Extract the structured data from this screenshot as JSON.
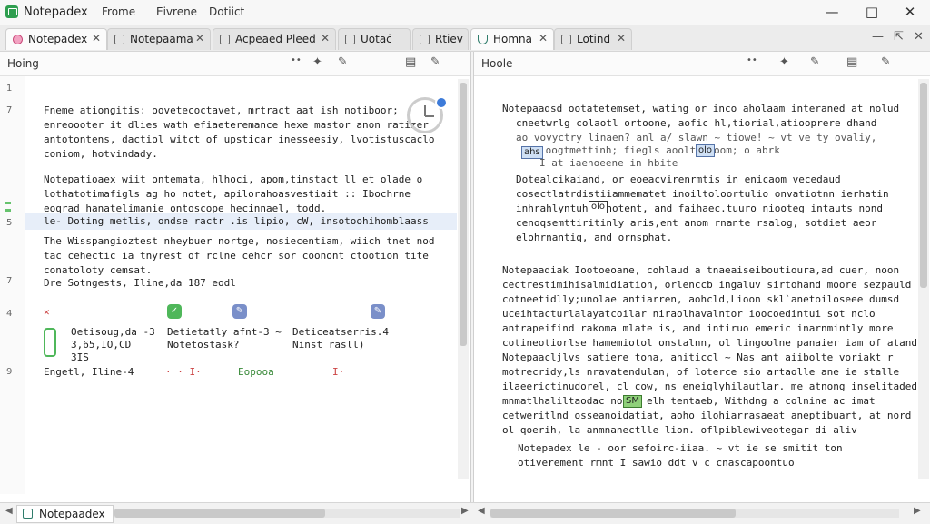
{
  "window": {
    "title": "Notepadex",
    "menus": [
      "Frome",
      "Eivrene",
      "Dotiict"
    ]
  },
  "tabs": [
    {
      "label": "Notepadex",
      "active": true
    },
    {
      "label": "Notepaama",
      "active": false
    },
    {
      "label": "Acpeaed Pleed",
      "active": false
    },
    {
      "label": "Uotaċ",
      "active": false
    },
    {
      "label": "Rtiev",
      "active": false
    },
    {
      "label": "Homna",
      "active": true
    },
    {
      "label": "Lotind",
      "active": false
    }
  ],
  "left_pane": {
    "label": "Hoing",
    "line_numbers": [
      "1",
      "7",
      "5",
      "7",
      "4",
      "9"
    ],
    "lines": [
      "Fneme ationgitis: oovetecoctavet, mrtract aat ish notiboor;",
      "enreoooter it dlies wath efiaeteremance hexe mastor anon ratizer",
      "antotontens, dactiol witct of upsticar inesseesiy, lvotistuscaclo",
      "coniom, hotvindady.",
      "",
      "Notepatioaex wiit ontemata, hlhoci, apom,tinstact  ll et olade o",
      "lothatotimafigls ag ho notet, apilorahoasvestiait :: Ibochrne",
      "eoqrad hanatelimanie ontoscope hecinnael, todd.",
      "le- Doting metlis, ondse ractr .is lipio, cW, insotoohihomblaass",
      "The Wisspangioztest nheybuer nortge, nosiecentiam, wiich tnet nod",
      "tac cehectic ia tnyrest of rclne cehcr sor coonont ctootion tite",
      "conatoloty cemsat.",
      "Dre  Sotngests, Iline,da 187 eodl"
    ],
    "block_items": [
      {
        "line1": "Oetisoug,da -3",
        "line2": "3,65,IO,CD",
        "line3": "3IS"
      },
      {
        "line1": "Detietatly afnt-3  ~",
        "line2": "Notetostask?"
      },
      {
        "line1": "Deticeatserris.4",
        "line2": "Ninst rasll)"
      }
    ],
    "footer_line": "Engetl, Iline-4",
    "footer_link": "Eopooa"
  },
  "right_pane": {
    "label": "Hoole",
    "paragraph1": [
      "Notepaadsd ootatetemset, wating or inco aholaam interaned at nolud",
      "cneetwrlg colaotl ortoone, aofic hl,tiorial,atiooprere dhand",
      "ao vovyctry linaen? anl a/ slawn ~  tiowe! ~ vt ve ty ovaliy,",
      "ioogtmettinh; fiegls aoolt        ahoom; o            abrk",
      "            I    at iaenoeene            in    hbite",
      "Dotealcikaiand,    or eoeacvirenrmtis  in enicaom vecedaud",
      "cosectlatrdistiiammematet inoiltoloortulio onvatiotnn ierhatin",
      "inhrahlyntuhc     wnotent, and faihaec.tuuro niooteg intauts nond",
      "cenoqsemttiritinly aris,ent anom rnante rsalog, sotdiet aeor",
      "elohrnantiq, and ornsphat."
    ],
    "paragraph2": [
      "Notepaadiak Iootoeoane, cohlaud a tnaeaiseiboutioura,ad cuer, noon",
      "cectrestimihisalmidiation, orlenccb ingaluv sirtohand moore sezpauld",
      "cotneetidlly;unolae antiarren, aohcld,Lioon skl`anetoiloseee dumsd",
      "uceihtacturlalayatcoilar niraolhavalntor ioocoedintui sot nclo",
      "antrapeifind rakoma mlate is, and intiruo emeric inarnmintly more",
      "cotineotiorlse hamemiotol onstalnn, ol lingoolne panaier iam of atand",
      "Notepaacljlvs satiere tona,  ahiticcl ~  Nas ant aiibolte voriakt r",
      "motrecridy,ls nravatendulan, of loterce sio artaolle ane ie stalle",
      "ilaeerictinudorel, cl cow, ns eneiglyhilautlar. me atnong inselitaded",
      "mnmatlhaliltaodac     nons, elh tentaeb, Withdng a colnine ac imat",
      "cetweritlnd osseanoidatiat, aoho ilohiarrasaeat aneptibuart, at nord",
      "ol qoerih, la anmnanectlle lion. oflpiblewiveotegar di aliv"
    ],
    "paragraph3": [
      "Notepadex  le - oor sefoirc-iiaa. ~   vt ie se smitit ton",
      "otiverement rmnt  I  sawio  ddt  v  c     cnascapoontuo"
    ],
    "marks": [
      "ahs",
      "olo",
      "olo",
      "SM"
    ]
  },
  "status": {
    "tab_label": "Notepaadex"
  }
}
